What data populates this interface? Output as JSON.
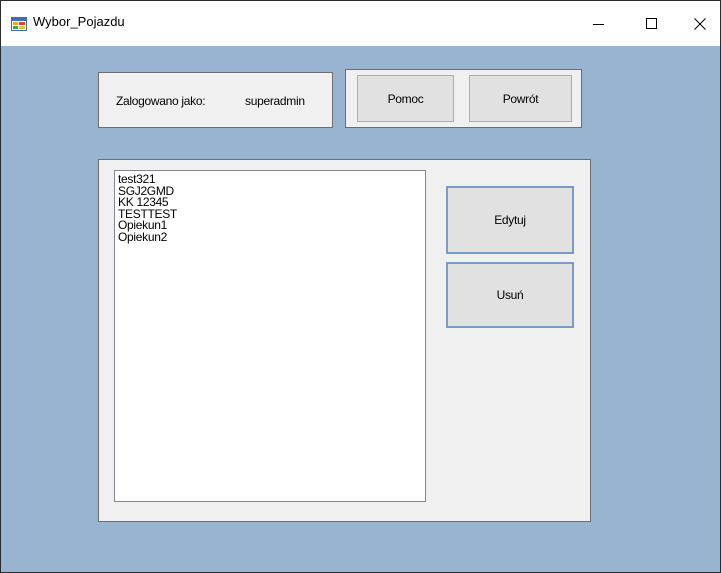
{
  "window": {
    "title": "Wybor_Pojazdu",
    "icon": "windows-form-icon",
    "background_color": "#99b4d1"
  },
  "login": {
    "label": "Zalogowano jako:",
    "username": "superadmin"
  },
  "nav": {
    "help_label": "Pomoc",
    "back_label": "Powrót"
  },
  "vehicles": {
    "items": [
      "test321",
      "SGJ2GMD",
      "KK 12345",
      "TESTTEST",
      "Opiekun1",
      "Opiekun2"
    ]
  },
  "actions": {
    "edit_label": "Edytuj",
    "delete_label": "Usuń"
  }
}
